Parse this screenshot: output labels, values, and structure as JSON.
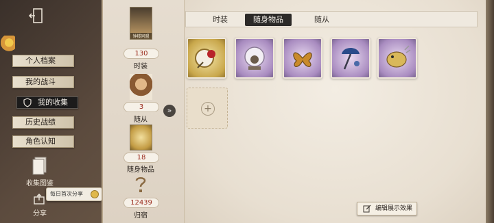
{
  "nav": {
    "items": [
      {
        "label": "个人档案",
        "active": false
      },
      {
        "label": "我的战斗",
        "active": false
      },
      {
        "label": "我的收集",
        "active": true
      },
      {
        "label": "历史战绩",
        "active": false
      },
      {
        "label": "角色认知",
        "active": false
      }
    ],
    "collection_album_label": "收集图鉴",
    "share_label": "分享",
    "share_bubble_text": "每日首次分享"
  },
  "categories": [
    {
      "name": "时装",
      "count": "130",
      "portrait_name": "钟楼同盟"
    },
    {
      "name": "随从",
      "count": "3"
    },
    {
      "name": "随身物品",
      "count": "18"
    },
    {
      "name": "归宿",
      "count": "12439"
    }
  ],
  "tabs": [
    {
      "label": "时装",
      "active": false
    },
    {
      "label": "随身物品",
      "active": true
    },
    {
      "label": "随从",
      "active": false
    }
  ],
  "items": [
    {
      "rarity": "gold",
      "icon": "rose-mirror-icon"
    },
    {
      "rarity": "purple",
      "icon": "crystal-ball-icon"
    },
    {
      "rarity": "purple",
      "icon": "butterfly-icon"
    },
    {
      "rarity": "purple",
      "icon": "umbrella-icon"
    },
    {
      "rarity": "purple",
      "icon": "pufferfish-icon"
    }
  ],
  "edit_button_label": "编辑展示效果",
  "colors": {
    "accent_red": "#9a2a1c",
    "active_dark": "#1c1b1b"
  }
}
